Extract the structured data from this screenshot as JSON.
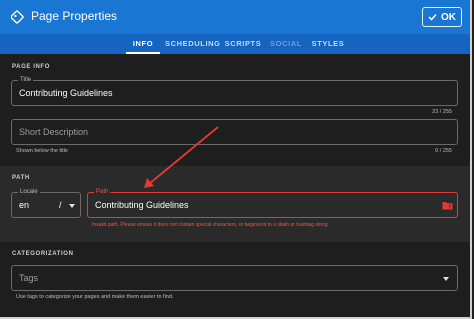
{
  "header": {
    "title": "Page Properties",
    "ok_label": "OK"
  },
  "tabs": [
    {
      "label": "INFO",
      "state": "active"
    },
    {
      "label": "SCHEDULING",
      "state": "normal"
    },
    {
      "label": "SCRIPTS",
      "state": "normal"
    },
    {
      "label": "SOCIAL",
      "state": "disabled"
    },
    {
      "label": "STYLES",
      "state": "normal"
    }
  ],
  "page_info": {
    "section_label": "PAGE INFO",
    "title_field": {
      "label": "Title",
      "value": "Contributing Guidelines",
      "counter": "23 / 255"
    },
    "description_field": {
      "placeholder": "Short Description",
      "hint": "Shown below the title",
      "counter": "0 / 255"
    }
  },
  "path": {
    "section_label": "PATH",
    "locale": {
      "label": "Locale",
      "value": "en",
      "separator": "/"
    },
    "path_field": {
      "label": "Path",
      "value": "Contributing Guidelines",
      "error": "Invalid path. Please ensure it does not contain special characters, or begin/end in a slash or hashtag string."
    }
  },
  "categorization": {
    "section_label": "CATEGORIZATION",
    "tags": {
      "placeholder": "Tags",
      "hint": "Use tags to categorize your pages and make them easier to find."
    }
  },
  "colors": {
    "accent": "#1976d2",
    "tabs_bg": "#1565c0",
    "error": "#e53935",
    "annotation_arrow": "#e53935"
  },
  "icons": {
    "header": "page-properties-icon",
    "ok": "check-icon",
    "path": "folder-alert-icon",
    "locale_dropdown": "chevron-down-icon",
    "tags_dropdown": "chevron-down-icon"
  }
}
